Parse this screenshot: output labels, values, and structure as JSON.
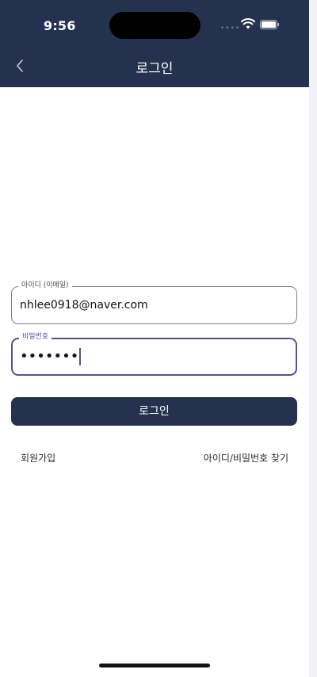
{
  "status_bar": {
    "time": "9:56",
    "signal_icon": "signal-dots-icon",
    "wifi_icon": "wifi-icon",
    "battery_icon": "battery-icon"
  },
  "header": {
    "title": "로그인",
    "back_icon": "chevron-left-icon",
    "background_color": "#25324f"
  },
  "form": {
    "email": {
      "label": "아이디 (이메일)",
      "value": "nhlee0918@naver.com"
    },
    "password": {
      "label": "비밀번호",
      "value": "•••••••"
    },
    "login_button_label": "로그인"
  },
  "links": {
    "signup": "회원가입",
    "find_account": "아이디/비밀번호 찾기"
  },
  "colors": {
    "primary": "#25324f",
    "focus": "#5e4b9d"
  }
}
